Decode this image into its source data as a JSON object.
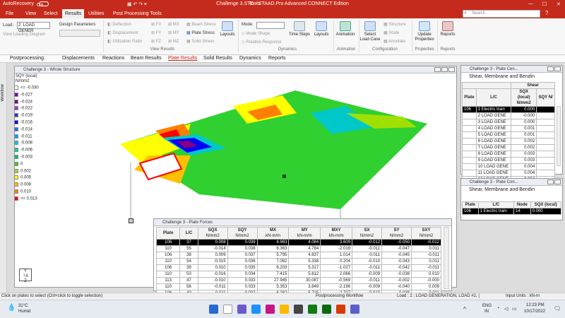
{
  "titlebar": {
    "autorecovery": "AutoRecovery",
    "autorecovery_state": "On",
    "tools": "Tools",
    "title": "Challenge 3.STD - STAAD.Pro Advanced CONNECT Edition"
  },
  "tabs": [
    "File",
    "View",
    "Select",
    "Results",
    "Utilities",
    "Post Processing Tools"
  ],
  "search_placeholder": "Search",
  "ribbon": {
    "load_label": "Load:",
    "load_value": "2: LOAD GENER",
    "view_loading": "View Loading Diagram",
    "design_params": "Design Parameters",
    "deflection": "Deflection",
    "displacement": "Displacement",
    "utilization": "Utilization Ratio",
    "fx": "FX",
    "fy": "FY",
    "fz": "FZ",
    "mx": "MX",
    "my": "MY",
    "mz": "MZ",
    "beam_stress": "Beam Stress",
    "plate_stress": "Plate Stress",
    "solid_stress": "Solid Stress",
    "layouts": "Layouts",
    "mode": "Mode:",
    "mode_shape": "Mode Shape",
    "relative_response": "Relative Response",
    "time_steps": "Time Steps",
    "layouts2": "Layouts",
    "animation": "Animation",
    "select_load_case": "Select Load Case",
    "structure": "Structure",
    "scale": "Scale",
    "annotate": "Annotate",
    "update_properties": "Update Properties",
    "reports": "Reports",
    "groups": {
      "view_results": "View Results",
      "dynamics": "Dynamics",
      "animation": "Animation",
      "configuration": "Configuration",
      "properties": "Properties",
      "reports": "Reports"
    }
  },
  "postbar": {
    "label": "Postprocessing:",
    "items": [
      "Displacements",
      "Reactions",
      "Beam Results",
      "Plate Results",
      "Solid Results",
      "Dynamics",
      "Reports"
    ],
    "active": "Plate Results"
  },
  "workflow_label": "Workflow",
  "structure_window": {
    "title": "Challenge 3 - Whole Structure",
    "legend_title": "SQY (local)",
    "legend_unit": "N/mm2",
    "legend": [
      {
        "t": "<= -0.030",
        "c": "#ffffff"
      },
      {
        "t": "-0.027",
        "c": "#6a0dad"
      },
      {
        "t": "-0.024",
        "c": "#800080"
      },
      {
        "t": "-0.022",
        "c": "#9b30ff"
      },
      {
        "t": "-0.019",
        "c": "#3030c0"
      },
      {
        "t": "-0.016",
        "c": "#0000ff"
      },
      {
        "t": "-0.014",
        "c": "#1e6eff"
      },
      {
        "t": "-0.011",
        "c": "#00a0ff"
      },
      {
        "t": "-0.008",
        "c": "#00c8c8"
      },
      {
        "t": "-0.006",
        "c": "#00d0a0"
      },
      {
        "t": "-0.003",
        "c": "#00c060"
      },
      {
        "t": "0",
        "c": "#30d030"
      },
      {
        "t": "0.002",
        "c": "#a0e000"
      },
      {
        "t": "0.005",
        "c": "#ffff00"
      },
      {
        "t": "0.008",
        "c": "#ffc000"
      },
      {
        "t": "0.010",
        "c": "#ff8000"
      },
      {
        "t": ">= 0.013",
        "c": "#ff0000"
      }
    ]
  },
  "shear_window": {
    "title": "Challenge 3 - Plate Cen...",
    "tab": "Shear, Membrane and Bendin",
    "group": "Shear",
    "headers": [
      "Plate",
      "L/C",
      "SQX (local) N/mm2",
      "SQY N/"
    ],
    "rows": [
      [
        "106",
        "1 Electric train",
        "0.000",
        ""
      ],
      [
        "",
        "2 LOAD GENE",
        "-0.000",
        ""
      ],
      [
        "",
        "3 LOAD GENE",
        "0.000",
        ""
      ],
      [
        "",
        "4 LOAD GENE",
        "0.001",
        ""
      ],
      [
        "",
        "5 LOAD GENE",
        "0.001",
        ""
      ],
      [
        "",
        "6 LOAD GENE",
        "0.002",
        ""
      ],
      [
        "",
        "7 LOAD GENE",
        "0.002",
        ""
      ],
      [
        "",
        "8 LOAD GENE",
        "0.003",
        ""
      ],
      [
        "",
        "9 LOAD GENE",
        "0.003",
        ""
      ],
      [
        "",
        "10 LOAD GENE",
        "0.004",
        ""
      ],
      [
        "",
        "11 LOAD GENE",
        "0.004",
        ""
      ],
      [
        "",
        "12 LOAD GENE",
        "0.004",
        ""
      ]
    ]
  },
  "corner_window": {
    "title": "Challenge 3 - Plate Con...",
    "tab": "Shear, Membrane and Bendin",
    "headers": [
      "Plate",
      "L/C",
      "Node",
      "SQX (local)"
    ],
    "row": [
      "106",
      "1 Electric train",
      "14",
      "0.000"
    ]
  },
  "forces_window": {
    "title": "Challenge 3 - Plate Forces",
    "headers": [
      [
        "Plate",
        ""
      ],
      [
        "L/C",
        ""
      ],
      [
        "SQX",
        "N/mm2"
      ],
      [
        "SQY",
        "N/mm2"
      ],
      [
        "MX",
        "kN-m/m"
      ],
      [
        "MY",
        "kN-m/m"
      ],
      [
        "MXY",
        "kN-m/m"
      ],
      [
        "SX",
        "N/mm2"
      ],
      [
        "SY",
        "N/mm2"
      ],
      [
        "SXY",
        "N/mm2"
      ]
    ],
    "rows": [
      [
        "106",
        "37",
        "0.008",
        "0.039",
        "4.963",
        "4.084",
        "3.609",
        "-0.012",
        "-0.050",
        "-0.012"
      ],
      [
        "110",
        "55",
        "-0.014",
        "0.038",
        "6.363",
        "4.784",
        "-2.016",
        "-0.011",
        "-0.047",
        "0.011"
      ],
      [
        "106",
        "38",
        "0.009",
        "0.037",
        "5.795",
        "4.837",
        "1.014",
        "-0.011",
        "-0.045",
        "-0.011"
      ],
      [
        "110",
        "54",
        "-0.015",
        "0.036",
        "7.082",
        "5.338",
        "0.204",
        "-0.010",
        "-0.043",
        "0.011"
      ],
      [
        "106",
        "39",
        "0.010",
        "0.035",
        "6.203",
        "5.317",
        "-1.027",
        "-0.011",
        "-0.042",
        "-0.011"
      ],
      [
        "110",
        "53",
        "-0.016",
        "0.034",
        "7.415",
        "5.812",
        "2.066",
        "-0.009",
        "-0.038",
        "0.010"
      ],
      [
        "113",
        "47",
        "-0.010",
        "0.033",
        "27.945",
        "30.087",
        "-0.569",
        "-0.011",
        "-0.002",
        "-0.000"
      ],
      [
        "110",
        "56",
        "-0.011",
        "0.033",
        "5.353",
        "3.849",
        "-2.196",
        "-0.009",
        "-0.040",
        "0.009"
      ],
      [
        "106",
        "40",
        "0.011",
        "0.032",
        "6.262",
        "5.715",
        "-2.707",
        "-0.010",
        "-0.038",
        "-0.011"
      ]
    ]
  },
  "status": {
    "hint": "Click on plates to select (Ctrl+click to toggle selection)",
    "workflow": "Postprocessing Workflow",
    "load": "Load : 2 : LOAD GENERATION, LOAD #2, (",
    "units": "Input Units : kN-m"
  },
  "taskbar": {
    "temp": "31°C",
    "weather": "Humid",
    "lang1": "ENG",
    "lang2": "IN",
    "time": "12:23 PM",
    "date": "10/17/2022"
  }
}
